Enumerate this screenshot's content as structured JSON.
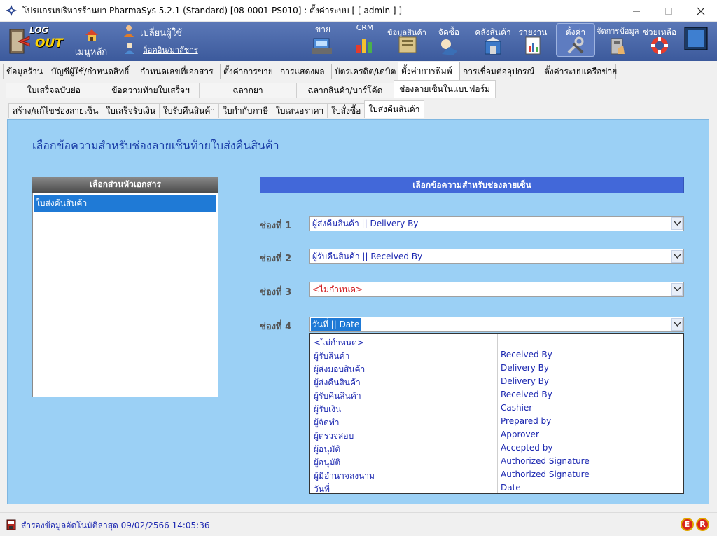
{
  "window": {
    "title": "โปรแกรมบริหารร้านยา PharmaSys 5.2.1 (Standard) [08-0001-PS010] : ตั้งค่าระบบ  [ [ admin ] ]"
  },
  "toolbar": {
    "logout_log": "LOG",
    "logout_out": "OUT",
    "home_label": "เมนูหลัก",
    "switch_user_label": "เปลี่ยนผู้ใช้",
    "user_name": "ล็อคอิน/มาลัชกร",
    "buttons": [
      {
        "label": "ขาย",
        "icon": "cashier-icon"
      },
      {
        "label": "CRM",
        "icon": "crm-chart-icon"
      },
      {
        "label": "ข้อมูลสินค้า",
        "icon": "product-data-icon"
      },
      {
        "label": "จัดซื้อ",
        "icon": "purchase-icon"
      },
      {
        "label": "คลังสินค้า",
        "icon": "warehouse-icon"
      },
      {
        "label": "รายงาน",
        "icon": "report-icon"
      },
      {
        "label": "ตั้งค่า",
        "icon": "settings-tools-icon"
      },
      {
        "label": "จัดการข้อมูล",
        "icon": "data-manage-icon"
      },
      {
        "label": "ช่วยเหลือ",
        "icon": "help-lifebuoy-icon"
      }
    ]
  },
  "tabs_level1": [
    "ข้อมูลร้าน",
    "บัญชีผู้ใช้/กำหนดสิทธิ์",
    "กำหนดเลขที่เอกสาร",
    "ตั้งค่าการขาย",
    "การแสดงผล",
    "บัตรเครดิต/เดบิต",
    "ตั้งค่าการพิมพ์",
    "การเชื่อมต่ออุปกรณ์",
    "ตั้งค่าระบบเครือข่าย"
  ],
  "tabs_level2": [
    "ใบเสร็จฉบับย่อ",
    "ข้อความท้ายใบเสร็จฯ",
    "ฉลากยา",
    "ฉลากสินค้า/บาร์โค้ด",
    "ช่องลายเซ็นในแบบฟอร์ม"
  ],
  "tabs_level3": [
    "สร้าง/แก้ไขช่องลายเซ็น",
    "ใบเสร็จรับเงิน",
    "ใบรับคืนสินค้า",
    "ใบกำกับภาษี",
    "ใบเสนอราคา",
    "ใบสั่งซื้อ",
    "ใบส่งคืนสินค้า"
  ],
  "main": {
    "heading": "เลือกข้อความสำหรับช่องลายเซ็นท้ายใบส่งคืนสินค้า",
    "left_header": "เลือกส่วนหัวเอกสาร",
    "left_items": [
      "ใบส่งคืนสินค้า"
    ],
    "right_header": "เลือกข้อความสำหรับช่องลายเซ็น",
    "slots": [
      {
        "label": "ช่องที่ 1",
        "value": "ผู้ส่งคืนสินค้า || Delivery By"
      },
      {
        "label": "ช่องที่ 2",
        "value": "ผู้รับคืนสินค้า || Received By"
      },
      {
        "label": "ช่องที่ 3",
        "value": "<ไม่กำหนด>"
      },
      {
        "label": "ช่องที่ 4",
        "value": "วันที่ || Date"
      }
    ]
  },
  "dropdown_options": [
    {
      "th": "<ไม่กำหนด>",
      "en": ""
    },
    {
      "th": "ผู้รับสินค้า",
      "en": "Received By"
    },
    {
      "th": "ผู้ส่งมอบสินค้า",
      "en": "Delivery By"
    },
    {
      "th": "ผู้ส่งคืนสินค้า",
      "en": "Delivery By"
    },
    {
      "th": "ผู้รับคืนสินค้า",
      "en": "Received By"
    },
    {
      "th": "ผู้รับเงิน",
      "en": "Cashier"
    },
    {
      "th": "ผู้จัดทำ",
      "en": "Prepared by"
    },
    {
      "th": "ผู้ตรวจสอบ",
      "en": "Approver"
    },
    {
      "th": "ผู้อนุมัติ",
      "en": "Accepted by"
    },
    {
      "th": "ผู้อนุมัติ",
      "en": "Authorized Signature"
    },
    {
      "th": "ผู้มีอำนาจลงนาม",
      "en": "Authorized Signature"
    },
    {
      "th": "วันที่",
      "en": "Date"
    }
  ],
  "status": {
    "text": "สำรองข้อมูลอัตโนมัติล่าสุด  09/02/2566 14:05:36",
    "badge_e": "E",
    "badge_r": "R"
  },
  "colors": {
    "toolbar": "#4a68ab",
    "content_bg": "#9bd0f5",
    "right_header": "#4268d9",
    "selected": "#1f7ad6",
    "link_text": "#1b27b0",
    "unset_text": "#d0171a"
  }
}
